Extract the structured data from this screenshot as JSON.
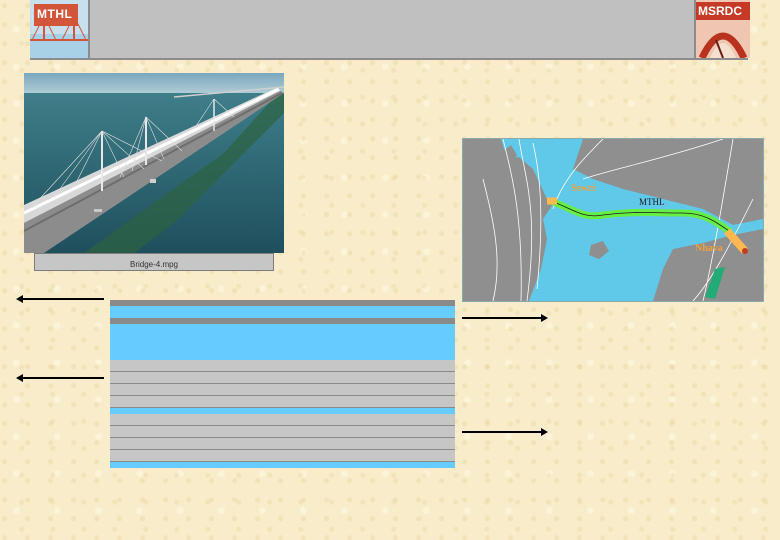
{
  "header": {
    "left_logo_text": "MTHL",
    "right_logo_text": "MSRDC"
  },
  "video": {
    "caption": "Bridge-4.mpg"
  },
  "map": {
    "labels": [
      "Sewri",
      "MTHL",
      "Nhava"
    ],
    "route_color": "#66ee44",
    "approach_color": "#ffb84d",
    "link_color": "#22aa77",
    "sea_color": "#60c8e8",
    "land_color": "#8f8f8f"
  },
  "colors": {
    "background": "#f8ecca",
    "header": "#c0c0c0",
    "table_blue": "#66ccff",
    "table_grey": "#c6c6c6"
  }
}
